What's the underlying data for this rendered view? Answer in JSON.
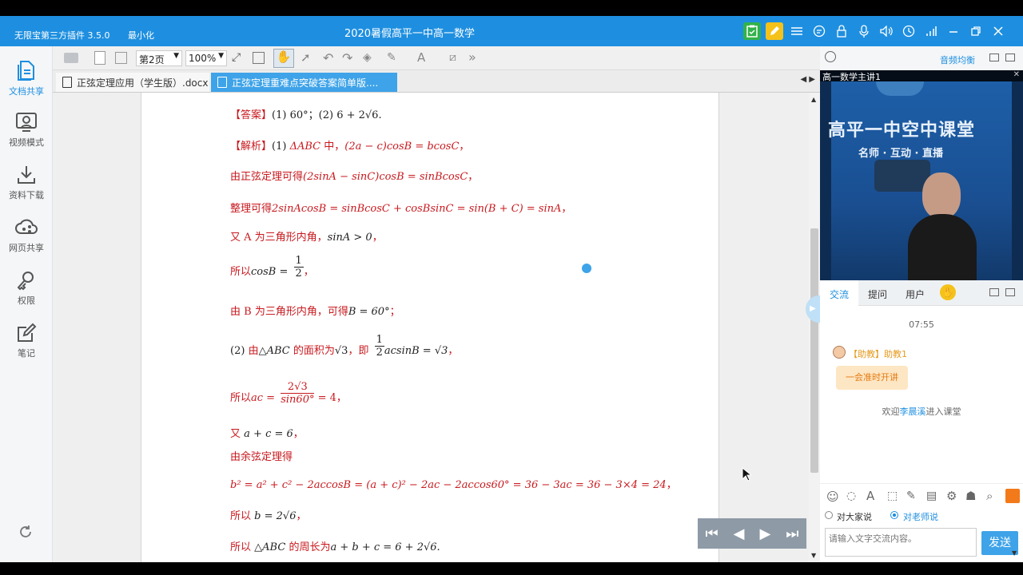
{
  "app": {
    "name": "无限宝第三方插件 3.5.0",
    "minimize_label": "最小化",
    "title": "2020暑假高平一中高一数学"
  },
  "sidebar": {
    "items": [
      {
        "label": "文档共享",
        "icon": "document-share-icon"
      },
      {
        "label": "视频模式",
        "icon": "video-mode-icon"
      },
      {
        "label": "资料下载",
        "icon": "download-icon"
      },
      {
        "label": "网页共享",
        "icon": "cloud-share-icon"
      },
      {
        "label": "权限",
        "icon": "key-icon"
      },
      {
        "label": "笔记",
        "icon": "note-icon"
      }
    ]
  },
  "toolbar": {
    "page_select": "第2页",
    "zoom_select": "100%",
    "font_tool": "A"
  },
  "tabs": [
    {
      "label": "正弦定理应用（学生版）.docx"
    },
    {
      "label": "正弦定理重难点突破答案简单版...."
    }
  ],
  "document": {
    "answer": {
      "tag": "【答案】",
      "p1": "(1)",
      "v1": "60°",
      "sep": "；",
      "p2": "(2)",
      "v2": "6 + 2√6",
      "end": "."
    },
    "analysis": {
      "tag": "【解析】",
      "part": "(1)",
      "tri": "ΔABC",
      "zh": "中，",
      "eq": "(2a − c)cosB = bcosC",
      "end": "，"
    },
    "line3": {
      "zh": "由正弦定理可得",
      "eq": "(2sinA − sinC)cosB = sinBcosC",
      "end": "，"
    },
    "line4": {
      "zh": "整理可得",
      "eq": "2sinAcosB = sinBcosC + cosBsinC = sin(B + C) = sinA",
      "end": "，"
    },
    "line5": {
      "zh": "又 A 为三角形内角，",
      "eq": "sinA > 0",
      "end": "，"
    },
    "line6": {
      "zh": "所以",
      "lhs": "cosB =",
      "num": "1",
      "den": "2",
      "end": "，"
    },
    "line7": {
      "zh": "由 B 为三角形内角，可得",
      "eq": "B = 60°",
      "end": "；"
    },
    "line8": {
      "part": "(2)",
      "zh1": "由",
      "tri": "△ABC",
      "zh2": "的面积为",
      "val": "√3",
      "zh3": "，即",
      "num": "1",
      "den": "2",
      "eq": "acsinB = √3",
      "end": "，"
    },
    "line9": {
      "zh": "所以",
      "lhs": "ac =",
      "num": "2√3",
      "den": "sin60°",
      "rhs": "= 4",
      "end": "，"
    },
    "line10": {
      "zh": "又",
      "eq": "a + c = 6",
      "end": "，"
    },
    "line11": {
      "zh": "由余弦定理得"
    },
    "line12": {
      "eq": "b² = a² + c² − 2accosB = (a + c)² − 2ac − 2accos60° = 36 − 3ac = 36 − 3×4 = 24",
      "end": "，"
    },
    "line13": {
      "zh": "所以",
      "eq": "b = 2√6",
      "end": "，"
    },
    "line14": {
      "zh1": "所以",
      "tri": "△ABC",
      "zh2": "的周长为",
      "eq": "a + b + c = 6 + 2√6",
      "end": "."
    }
  },
  "right_panel": {
    "freq_label": "音频均衡",
    "video_caption": "高一数学主讲1",
    "banner_main": "高平一中空中课堂",
    "banner_sub": "名师 · 互动 · 直播",
    "chat_tabs": [
      "交流",
      "提问",
      "用户"
    ],
    "chat": {
      "time": "07:55",
      "sender": "【助教】助教1",
      "bubble": "一会准时开讲",
      "welcome_pre": "欢迎",
      "welcome_name": "李晨溪",
      "welcome_post": "进入课堂"
    },
    "radio_all": "对大家说",
    "radio_teacher": "对老师说",
    "input_placeholder": "请输入文字交流内容。",
    "send_label": "发送"
  },
  "colors": {
    "accent": "#1e8fe0",
    "doc_red": "#c8191e",
    "send_button": "#3ea3e8"
  }
}
